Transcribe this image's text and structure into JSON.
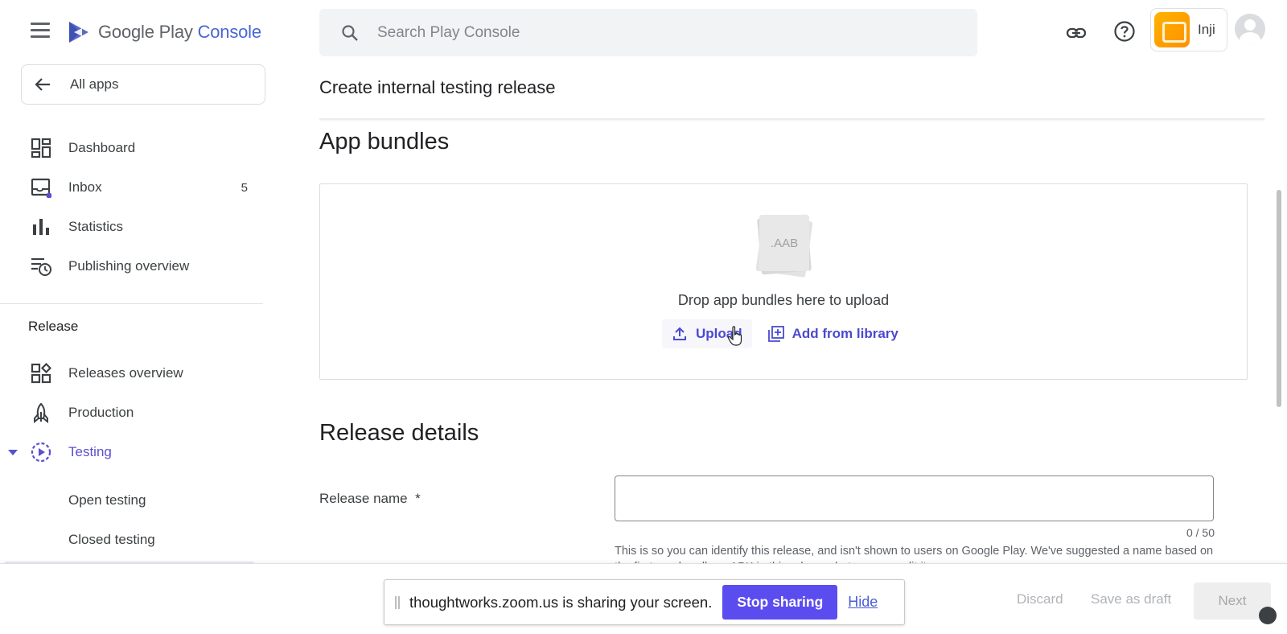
{
  "header": {
    "logo_text_main": "Google Play",
    "logo_text_console": "Console",
    "search_placeholder": "Search Play Console",
    "app_name": "Inji"
  },
  "sidebar": {
    "all_apps": "All apps",
    "items": [
      {
        "label": "Dashboard",
        "icon": "dashboard-icon"
      },
      {
        "label": "Inbox",
        "icon": "inbox-icon",
        "count": "5"
      },
      {
        "label": "Statistics",
        "icon": "bar-chart-icon"
      },
      {
        "label": "Publishing overview",
        "icon": "publishing-overview-icon"
      }
    ],
    "release_section": "Release",
    "release_items": [
      {
        "label": "Releases overview",
        "icon": "releases-overview-icon"
      },
      {
        "label": "Production",
        "icon": "rocket-icon"
      },
      {
        "label": "Testing",
        "icon": "testing-icon",
        "active": true
      }
    ],
    "testing_sub": [
      "Open testing",
      "Closed testing"
    ]
  },
  "main": {
    "page_title": "Create internal testing release",
    "app_bundles_heading": "App bundles",
    "aab_label": ".AAB",
    "drop_text": "Drop app bundles here to upload",
    "upload_label": "Upload",
    "add_library_label": "Add from library",
    "release_details_heading": "Release details",
    "release_name_label": "Release name",
    "required_mark": "*",
    "release_name_value": "",
    "char_count": "0 / 50",
    "help_text": "This is so you can identify this release, and isn't shown to users on Google Play. We've suggested a name based on the first app bundle or APK in this release, but you can edit it."
  },
  "footer": {
    "discard": "Discard",
    "save_draft": "Save as draft",
    "next": "Next"
  },
  "share_bar": {
    "message": "thoughtworks.zoom.us is sharing your screen.",
    "stop": "Stop sharing",
    "hide": "Hide"
  },
  "colors": {
    "accent": "#5a4fcf",
    "stop_button": "#5b4cf0",
    "link": "#4a4ad0"
  }
}
